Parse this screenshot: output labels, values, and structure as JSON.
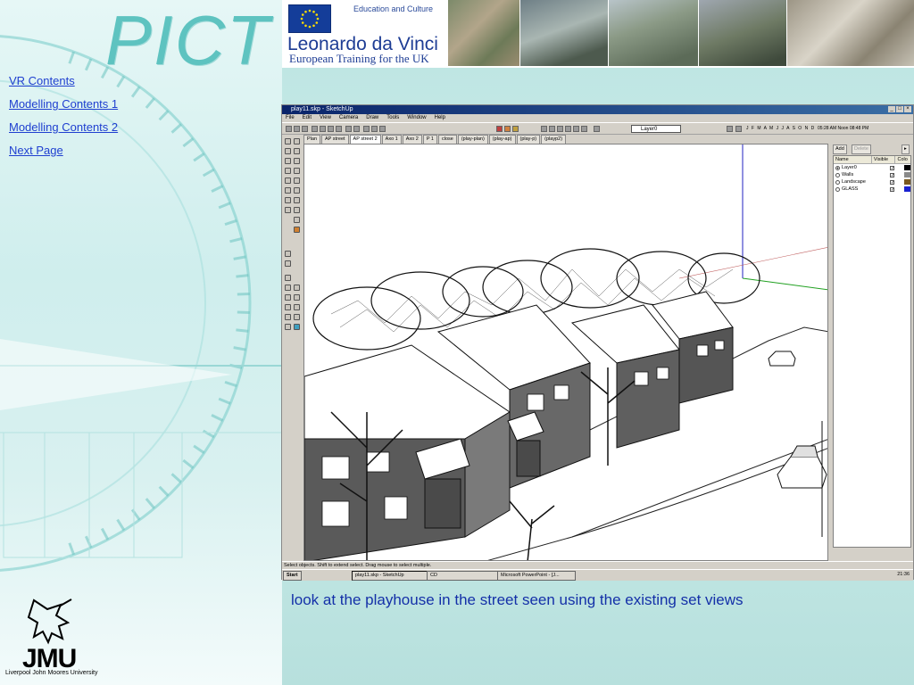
{
  "nav": {
    "logo": "PICT",
    "links": [
      {
        "label": "VR Contents"
      },
      {
        "label": "Modelling Contents 1"
      },
      {
        "label": "Modelling Contents 2"
      },
      {
        "label": "Next Page"
      }
    ]
  },
  "banner": {
    "tagline": "Education and Culture",
    "title": "Leonardo da Vinci",
    "subtitle": "European Training for the UK"
  },
  "branding": {
    "jmu_text": "JMU",
    "university": "Liverpool John Moores University"
  },
  "app": {
    "title": "play11.skp - SketchUp",
    "menus": [
      "File",
      "Edit",
      "View",
      "Camera",
      "Draw",
      "Tools",
      "Window",
      "Help"
    ],
    "layer_selected": "Layer0",
    "shadow_months": "J F M A M J J A S O N D",
    "shadow_times": "05:28 AM      Noon      08:48 PM",
    "scene_tabs": [
      "Plan",
      "AP street",
      "AP street 2",
      "Axo 1",
      "Axo 2",
      "P 1",
      "close",
      "(play-plan)",
      "(play-ap)",
      "(play-p)",
      "(playp2)"
    ],
    "active_tab_index": 2,
    "layers_panel": {
      "add_label": "Add",
      "delete_label": "Delete",
      "columns": [
        "Name",
        "Visible",
        "Colo"
      ],
      "rows": [
        {
          "name": "Layer0",
          "color": "#000000"
        },
        {
          "name": "Walls",
          "color": "#8a8a8a"
        },
        {
          "name": "Landscape",
          "color": "#7a5a20"
        },
        {
          "name": "GLASS",
          "color": "#1a22d0"
        }
      ]
    },
    "status": "Select objects. Shift to extend select. Drag mouse to select multiple."
  },
  "taskbar": {
    "start": "Start",
    "tasks": [
      "play11.skp - SketchUp",
      "CD",
      "Microsoft PowerPoint - [J..."
    ],
    "clock": "21:36"
  },
  "caption": "look at the playhouse in the street seen using the existing set views",
  "colors": {
    "link": "#1f3fd0",
    "caption": "#1430a8",
    "teal": "#5ec3c0",
    "titlebar": "#0a246a"
  }
}
